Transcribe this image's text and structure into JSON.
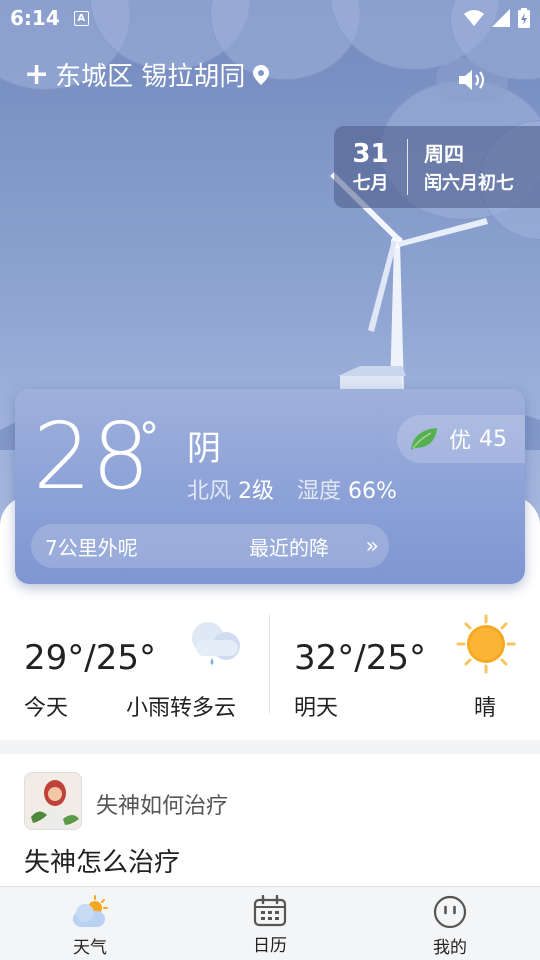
{
  "status_bar": {
    "time": "6:14",
    "notification_letter": "A"
  },
  "location": {
    "name": "东城区 锡拉胡同"
  },
  "date": {
    "day": "31",
    "month": "七月",
    "weekday": "周四",
    "lunar": "闰六月初七"
  },
  "current": {
    "temperature": "28",
    "degree_symbol": "°",
    "condition": "阴",
    "wind_direction": "北风",
    "wind_level": "2级",
    "humidity_label": "湿度",
    "humidity_value": "66%",
    "aqi_label": "优",
    "aqi_value": "45",
    "rain_ticker_part1": "7公里外呢",
    "rain_ticker_part2": "最近的降",
    "ticker_arrow": "»"
  },
  "forecast": {
    "today": {
      "temp": "29°/25°",
      "day_label": "今天",
      "condition": "小雨转多云",
      "icon": "cloud-rain-icon"
    },
    "tomorrow": {
      "temp": "32°/25°",
      "day_label": "明天",
      "condition": "晴",
      "icon": "sun-icon"
    }
  },
  "feed": {
    "subtitle": "失神如何治疗",
    "title": "失神怎么治疗"
  },
  "bottom_nav": [
    {
      "label": "天气",
      "icon": "weather-icon"
    },
    {
      "label": "日历",
      "icon": "calendar-icon"
    },
    {
      "label": "我的",
      "icon": "profile-face-icon"
    }
  ],
  "colors": {
    "hero_top": "#7389bd",
    "card": "#8aa0d6",
    "leaf_green": "#56b04f",
    "sun_orange": "#f7a823"
  }
}
